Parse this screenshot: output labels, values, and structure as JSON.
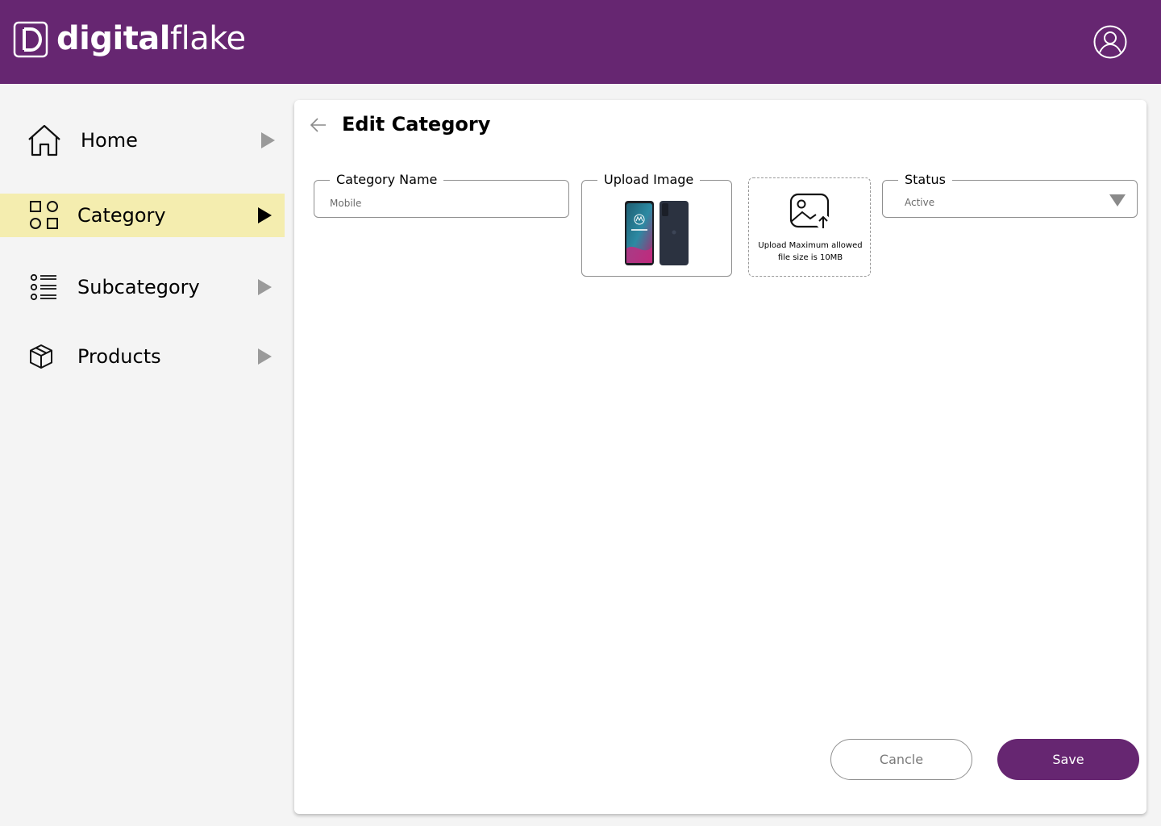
{
  "brand": {
    "name_bold": "digital",
    "name_light": "flake",
    "color": "#662671"
  },
  "header": {
    "profile_icon": "user-circle-icon"
  },
  "sidebar": {
    "active_color": "#f4edaf",
    "items": [
      {
        "label": "Home",
        "icon": "home-icon",
        "active": false
      },
      {
        "label": "Category",
        "icon": "category-grid-icon",
        "active": true
      },
      {
        "label": "Subcategory",
        "icon": "list-icon",
        "active": false
      },
      {
        "label": "Products",
        "icon": "box-icon",
        "active": false
      }
    ]
  },
  "page": {
    "title": "Edit Category",
    "back_icon": "arrow-left-icon"
  },
  "form": {
    "category_name": {
      "label": "Category Name",
      "value": "Mobile"
    },
    "upload_image": {
      "label": "Upload Image",
      "preview": "phone-preview-image"
    },
    "upload_box": {
      "icon": "image-upload-icon",
      "text_line1": "Upload Maximum allowed",
      "text_line2": "file size is 10MB"
    },
    "status": {
      "label": "Status",
      "value": "Active",
      "icon": "caret-down-icon"
    }
  },
  "actions": {
    "cancel_label": "Cancle",
    "save_label": "Save"
  }
}
